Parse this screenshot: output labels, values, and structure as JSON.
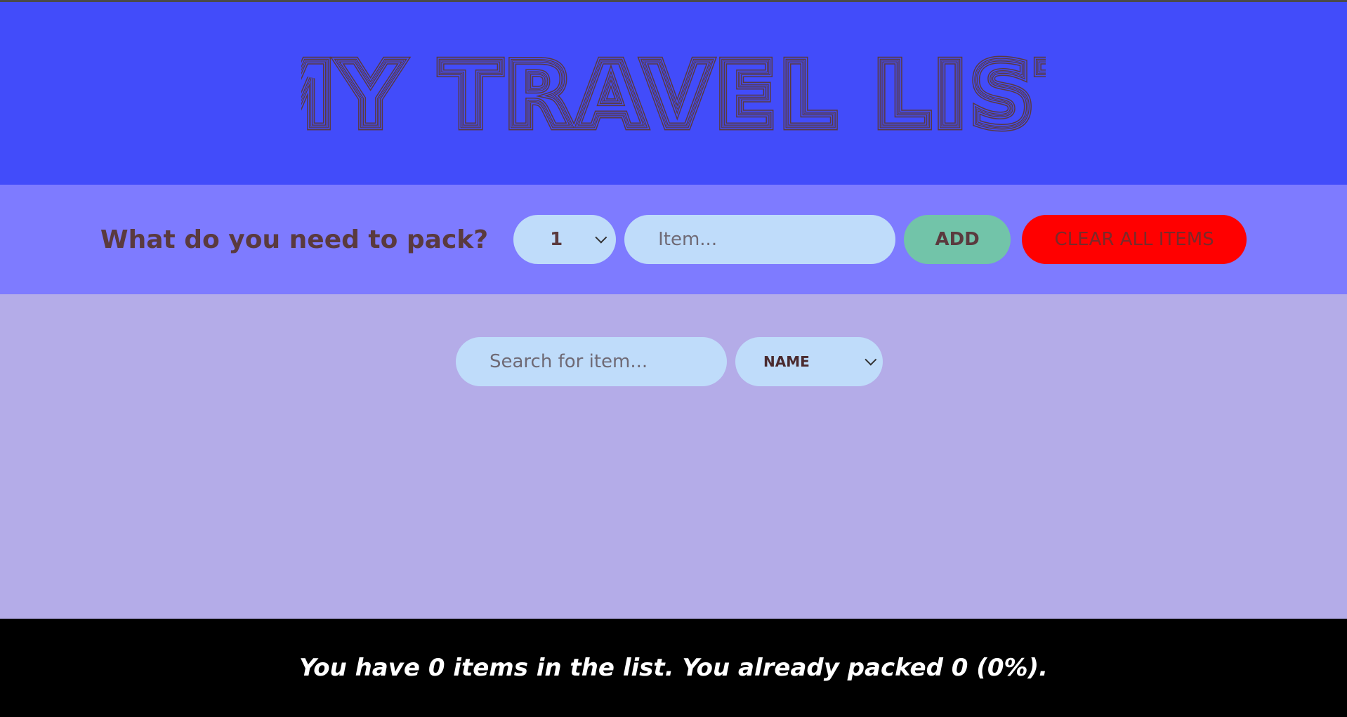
{
  "header": {
    "title": "MY TRAVEL LIST"
  },
  "form": {
    "prompt": "What do you need to pack?",
    "quantity_selected": "1",
    "item_placeholder": "Item...",
    "add_label": "ADD",
    "clear_label": "CLEAR ALL ITEMS"
  },
  "list": {
    "search_placeholder": "Search for item...",
    "sort_selected": "NAME"
  },
  "footer": {
    "stats": "You have 0 items in the list. You already packed 0 (0%)."
  },
  "colors": {
    "header_bg": "#424cfa",
    "form_bg": "#7e7bff",
    "list_bg": "#b4ace8",
    "footer_bg": "#000000",
    "input_bg": "#bfdcfa",
    "add_button": "#72c4a9",
    "clear_button": "#ff0000",
    "text_dark": "#5a3a3e"
  }
}
